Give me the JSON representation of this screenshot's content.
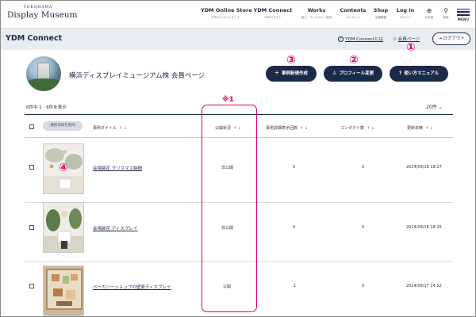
{
  "header": {
    "logo_small": "YOKOHAMA",
    "logo_main": "Display Museum",
    "nav": [
      {
        "label": "YDM Online Store",
        "sub": "YDMオンラインストア"
      },
      {
        "label": "YDM Connect",
        "sub": "YDMコネクト"
      },
      {
        "label": "Works",
        "sub": "施工・ディスプレイ実例"
      },
      {
        "label": "Contents",
        "sub": "コンテンツ"
      },
      {
        "label": "Shop",
        "sub": "店舗情報"
      },
      {
        "label": "Log In",
        "sub": "ログイン"
      }
    ],
    "lang_sub": "日本語",
    "search_sub": "検索",
    "menu_label": "MENU"
  },
  "subheader": {
    "title": "YDM Connect",
    "about_link": "YDM Connectとは",
    "member_link": "会員ページ",
    "logout": "ログアウト"
  },
  "profile": {
    "name": "横浜ディスプレイミュージアム株 会員ページ",
    "buttons": {
      "create_case": "事例新規作成",
      "edit_profile": "プロフィール変更",
      "manual": "使い方マニュアル"
    }
  },
  "annotations": {
    "a1": "①",
    "a2": "②",
    "a3": "③",
    "a4": "④",
    "note": "※1"
  },
  "list": {
    "count_text": "6件中 1 - 6件を表示",
    "per_page": "20件",
    "bulk_delete": "選択項目を削除",
    "columns": {
      "title": "事例タイトル",
      "status": "公開状況",
      "views": "事例詳細表示回数",
      "contacts": "コンタクト数",
      "updated": "更新日時"
    },
    "rows": [
      {
        "title": "会場装花 クリスマス装飾",
        "status": "非公開",
        "views": "0",
        "contacts": "0",
        "updated": "2024/09/18 18:27"
      },
      {
        "title": "会場装花 ディスプレイ",
        "status": "非公開",
        "views": "0",
        "contacts": "0",
        "updated": "2024/09/18 18:25"
      },
      {
        "title": "ベーカリーショップの壁面ディスプレイ",
        "status": "公開",
        "views": "1",
        "contacts": "0",
        "updated": "2024/09/17 14:52"
      }
    ]
  },
  "icons": {
    "about": "info-circle-icon",
    "member": "person-icon",
    "logout": "logout-icon",
    "plus": "plus-icon",
    "user": "user-icon",
    "help": "question-icon",
    "globe": "globe-icon",
    "search": "search-icon",
    "sort": "sort-arrows-icon"
  },
  "colors": {
    "navy": "#1c2a4a",
    "accent": "#e0006a",
    "band": "#e8edf1"
  }
}
